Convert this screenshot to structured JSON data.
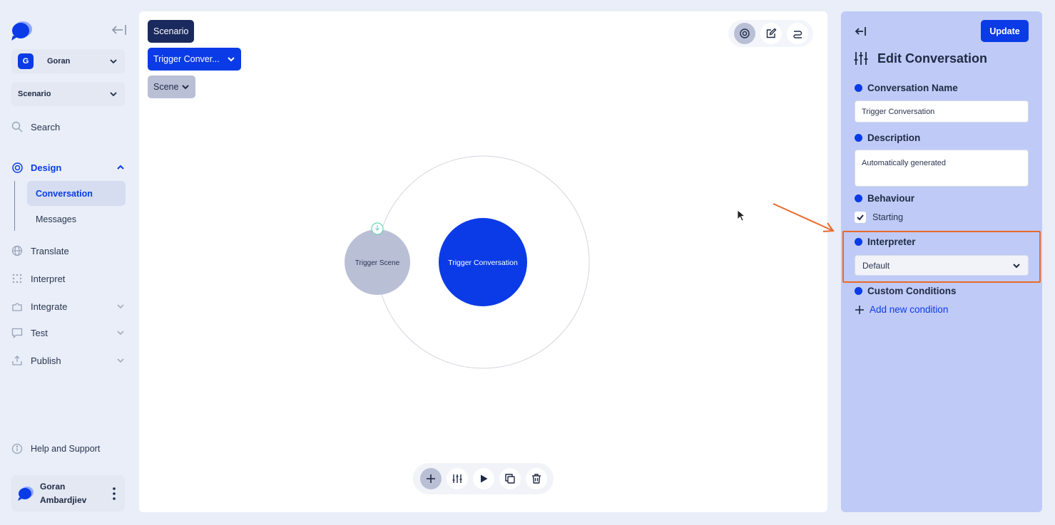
{
  "sidebar": {
    "workspace": {
      "badge": "G",
      "name": "Goran"
    },
    "scenario_select": "Scenario",
    "nav": {
      "search": "Search",
      "design": "Design",
      "conversation": "Conversation",
      "messages": "Messages",
      "translate": "Translate",
      "interpret": "Interpret",
      "integrate": "Integrate",
      "test": "Test",
      "publish": "Publish",
      "help": "Help and Support"
    },
    "user": {
      "name_line1": "Goran",
      "name_line2": "Ambardjiev"
    }
  },
  "canvas": {
    "breadcrumbs": {
      "scenario": "Scenario",
      "trigger": "Trigger Conver...",
      "scene": "Scene"
    },
    "nodes": {
      "scene": "Trigger Scene",
      "conversation": "Trigger Conversation"
    }
  },
  "panel": {
    "update_label": "Update",
    "title": "Edit Conversation",
    "conversation_name_label": "Conversation Name",
    "conversation_name_value": "Trigger Conversation",
    "description_label": "Description",
    "description_value": "Automatically generated",
    "behaviour_label": "Behaviour",
    "starting_label": "Starting",
    "starting_checked": true,
    "interpreter_label": "Interpreter",
    "interpreter_value": "Default",
    "custom_conditions_label": "Custom Conditions",
    "add_condition_label": "Add new condition"
  },
  "colors": {
    "primary": "#0a3be6",
    "panel_bg": "#bfcaf6",
    "highlight": "#ea6a2a",
    "node_scene": "#b9c0d6"
  }
}
